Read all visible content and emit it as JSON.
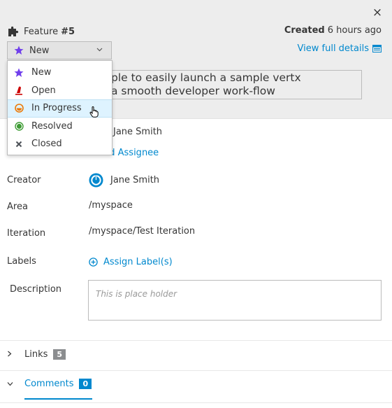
{
  "header": {
    "item_type": "Feature",
    "item_number": "#5",
    "created_label": "Created",
    "created_value": "6 hours ago",
    "view_details": "View full details",
    "close_glyph": "×"
  },
  "state_select": {
    "selected": "New",
    "chevron": "⌄"
  },
  "state_menu": [
    {
      "label": "New",
      "icon": "star-icon",
      "color": "#703fec"
    },
    {
      "label": "Open",
      "icon": "fire-extinguisher-icon",
      "color": "#cc0000"
    },
    {
      "label": "In Progress",
      "icon": "progress-ring-icon",
      "color": "#ec7a08",
      "hovered": true
    },
    {
      "label": "Resolved",
      "icon": "resolved-dot-icon",
      "color": "#3f9c35"
    },
    {
      "label": "Closed",
      "icon": "close-x-icon",
      "color": "#4d5258"
    }
  ],
  "title": {
    "line1": "ple to easily launch a sample vertx",
    "line2": "a smooth developer work-flow"
  },
  "assignees": {
    "name": "Jane Smith",
    "add_label": "Add Assignee",
    "add_label_visible": "dd Assignee"
  },
  "fields": {
    "creator_label": "Creator",
    "creator_value": "Jane Smith",
    "area_label": "Area",
    "area_value": "/myspace",
    "iteration_label": "Iteration",
    "iteration_value": "/myspace/Test Iteration",
    "labels_label": "Labels",
    "labels_action": "Assign Label(s)",
    "description_label": "Description",
    "description_placeholder": "This is place holder"
  },
  "sections": {
    "links_label": "Links",
    "links_count": "5",
    "links_toggle": "›",
    "comments_label": "Comments",
    "comments_count": "0",
    "comments_toggle": "⌄"
  },
  "colors": {
    "accent": "#0088ce",
    "header_bg": "#ededed",
    "hover_bg": "#def3ff"
  }
}
